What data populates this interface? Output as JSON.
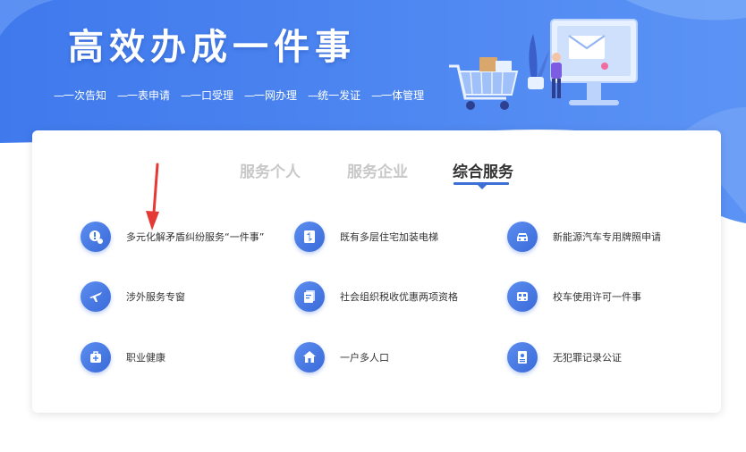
{
  "banner": {
    "title": "高效办成一件事",
    "slogans": [
      "一次告知",
      "一表申请",
      "一口受理",
      "一网办理",
      "统一发证",
      "一体管理"
    ]
  },
  "tabs": [
    {
      "label": "服务个人",
      "active": false
    },
    {
      "label": "服务企业",
      "active": false
    },
    {
      "label": "综合服务",
      "active": true
    }
  ],
  "services": [
    {
      "label": "多元化解矛盾纠纷服务“一件事”",
      "icon": "dispute-icon"
    },
    {
      "label": "既有多层住宅加装电梯",
      "icon": "elevator-icon"
    },
    {
      "label": "新能源汽车专用牌照申请",
      "icon": "car-icon"
    },
    {
      "label": "涉外服务专窗",
      "icon": "airplane-icon"
    },
    {
      "label": "社会组织税收优惠两项资格",
      "icon": "tax-icon"
    },
    {
      "label": "校车使用许可一件事",
      "icon": "bus-icon"
    },
    {
      "label": "职业健康",
      "icon": "medical-kit-icon"
    },
    {
      "label": "一户多人口",
      "icon": "house-icon"
    },
    {
      "label": "无犯罪记录公证",
      "icon": "certificate-icon"
    }
  ],
  "colors": {
    "banner_blue": "#4f86f2",
    "accent": "#3e6fd6",
    "annotation_arrow": "#e53935"
  }
}
